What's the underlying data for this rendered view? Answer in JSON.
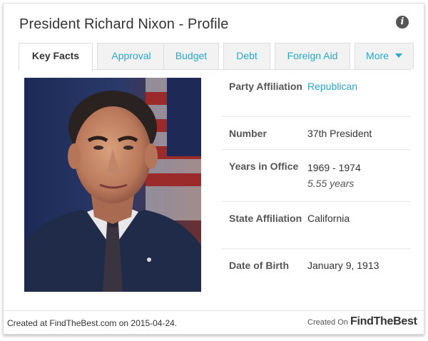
{
  "header": {
    "title": "President Richard Nixon - Profile",
    "info_icon": "info-icon"
  },
  "tabs": [
    {
      "label": "Key Facts",
      "active": true
    },
    {
      "label": "Approval"
    },
    {
      "label": "Budget"
    },
    {
      "label": "Debt"
    },
    {
      "label": "Foreign Aid"
    },
    {
      "label": "More"
    }
  ],
  "facts": [
    {
      "label": "Party Affiliation",
      "value": "Republican"
    },
    {
      "label": "Number",
      "value": "37th President"
    },
    {
      "label": "Years in Office",
      "value": "1969 - 1974",
      "sub": "5.55 years"
    },
    {
      "label": "State Affiliation",
      "value": "California"
    },
    {
      "label": "Date of Birth",
      "value": "January 9, 1913"
    }
  ],
  "footer": {
    "created_text": "Created at FindTheBest.com on 2015-04-24.",
    "created_on": "Created On",
    "brand": "FindTheBest"
  },
  "colors": {
    "link": "#2ba6cb",
    "tab_bg": "#f2f2f2",
    "border": "#dddddd"
  }
}
